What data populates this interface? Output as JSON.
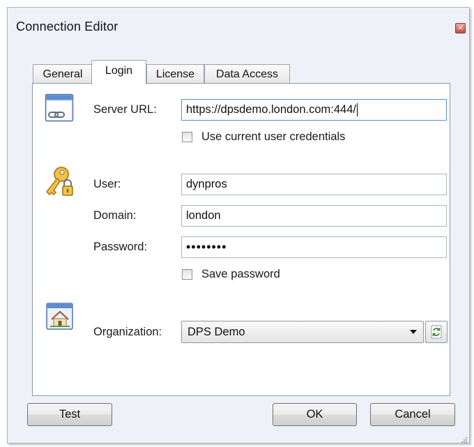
{
  "window": {
    "title": "Connection Editor",
    "close_glyph": "×"
  },
  "tabs": [
    {
      "label": "General",
      "active": false
    },
    {
      "label": "Login",
      "active": true
    },
    {
      "label": "License",
      "active": false
    },
    {
      "label": "Data Access",
      "active": false
    }
  ],
  "server": {
    "icon": "server-link-icon",
    "label": "Server URL:",
    "value": "https://dpsdemo.london.com:444/",
    "use_current_credentials": {
      "label": "Use current user credentials",
      "checked": false
    }
  },
  "credentials": {
    "icon": "key-lock-icon",
    "user_label": "User:",
    "user_value": "dynpros",
    "domain_label": "Domain:",
    "domain_value": "london",
    "password_label": "Password:",
    "password_masked": "••••••••",
    "save_password": {
      "label": "Save password",
      "checked": false
    }
  },
  "organization": {
    "icon": "organization-house-icon",
    "label": "Organization:",
    "selected": "DPS Demo",
    "refresh_icon": "refresh-icon"
  },
  "buttons": {
    "test": "Test",
    "ok": "OK",
    "cancel": "Cancel"
  },
  "colors": {
    "window_bg": "#eef2f8",
    "focus_border": "#5d8ec7",
    "close_red": "#c14b42"
  }
}
